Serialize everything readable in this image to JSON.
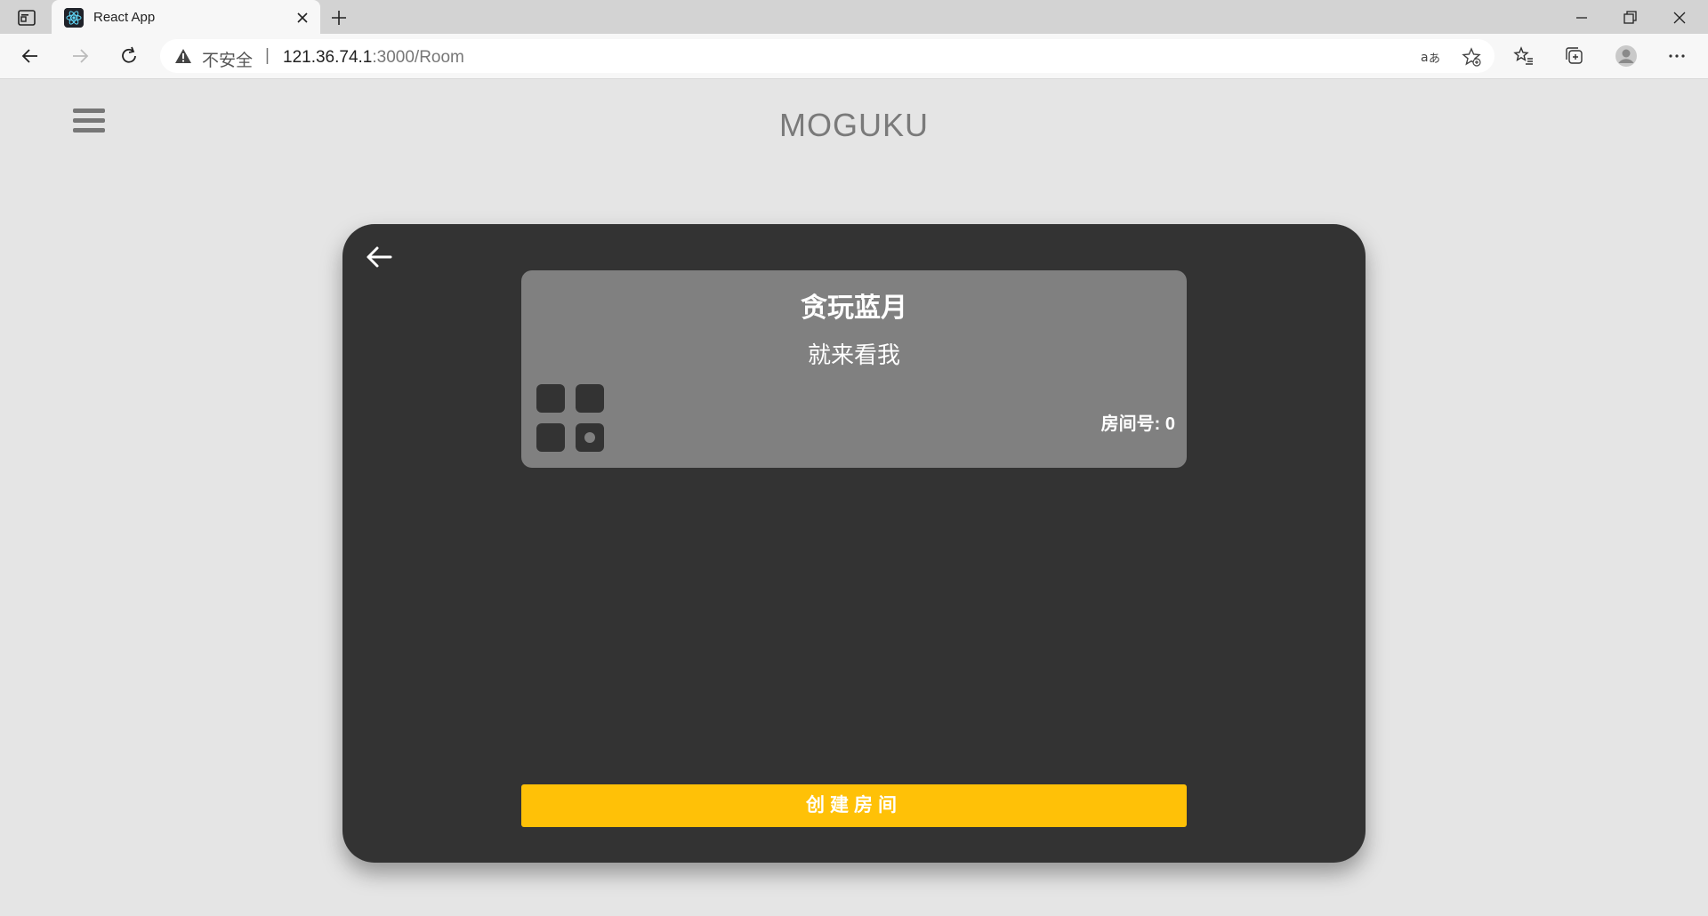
{
  "browser": {
    "tab_title": "React App",
    "address": {
      "security_label": "不安全",
      "separator": "|",
      "host": "121.36.74.1",
      "path": ":3000/Room"
    }
  },
  "header": {
    "title": "MOGUKU"
  },
  "room": {
    "name": "贪玩蓝月",
    "description": "就来看我",
    "number_label": "房间号: 0",
    "seats": [
      {
        "occupied": false
      },
      {
        "occupied": false
      },
      {
        "occupied": false
      },
      {
        "occupied": true
      }
    ]
  },
  "actions": {
    "create_room_label": "创建房间"
  },
  "colors": {
    "page_bg": "#e5e5e5",
    "panel_bg": "#333333",
    "card_bg": "#808080",
    "accent": "#ffc107"
  }
}
